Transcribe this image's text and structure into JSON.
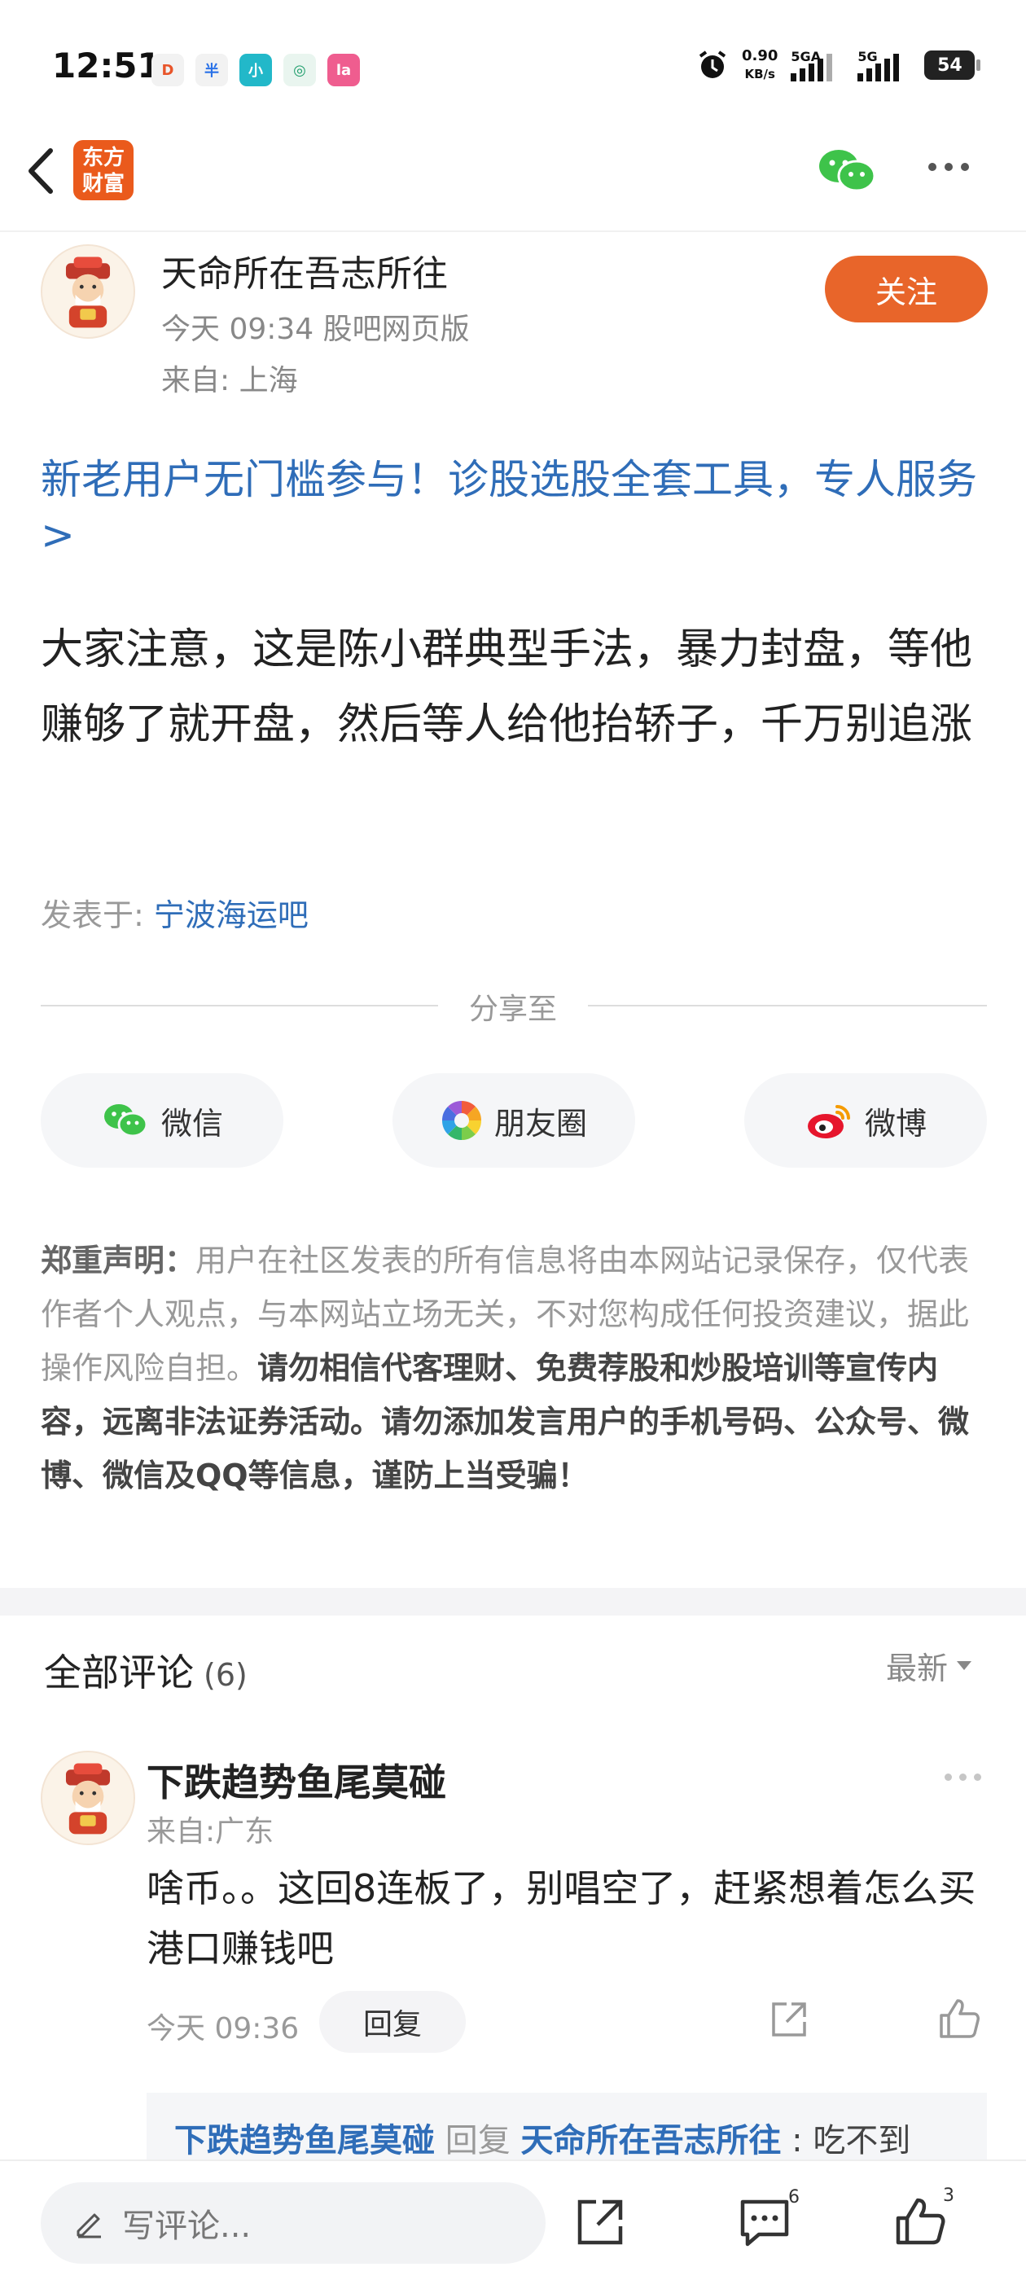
{
  "status_bar": {
    "time": "12:51",
    "app_icons": [
      {
        "icon": "taobao-icon",
        "glyph": "D",
        "color": "#f2f2f2",
        "fg": "#e8552a"
      },
      {
        "icon": "alipay-icon",
        "glyph": "半",
        "color": "#f2f2f2",
        "fg": "#2a72e8"
      },
      {
        "icon": "miniapp-icon",
        "glyph": "小",
        "color": "#22b8c9",
        "fg": "#ffffff"
      },
      {
        "icon": "vpn-icon",
        "glyph": "◎",
        "color": "#e9f5ef",
        "fg": "#1d9d6b"
      },
      {
        "icon": "lalala-icon",
        "glyph": "la",
        "color": "#ef5d8f",
        "fg": "#ffffff"
      }
    ],
    "net_speed_value": "0.90",
    "net_speed_unit": "KB/s",
    "signal1_label": "5GA",
    "signal2_label": "5G",
    "battery": "54"
  },
  "header": {
    "logo_line1": "东方",
    "logo_line2": "财富"
  },
  "post": {
    "author": "天命所在吾志所往",
    "time_source": "今天 09:34 股吧网页版",
    "location": "来自: 上海",
    "follow_label": "关注",
    "promo": "新老用户无门槛参与！诊股选股全套工具，专人服务>",
    "body": "大家注意，这是陈小群典型手法，暴力封盘，等他赚够了就开盘，然后等人给他抬轿子，千万别追涨",
    "posted_in_label": "发表于: ",
    "posted_in_bar": "宁波海运吧"
  },
  "share": {
    "title": "分享至",
    "options": [
      {
        "label": "微信",
        "icon": "wechat-icon"
      },
      {
        "label": "朋友圈",
        "icon": "moments-icon"
      },
      {
        "label": "微博",
        "icon": "weibo-icon"
      }
    ]
  },
  "disclaimer": {
    "lead": "郑重声明：",
    "normal": "用户在社区发表的所有信息将由本网站记录保存，仅代表作者个人观点，与本网站立场无关，不对您构成任何投资建议，据此操作风险自担。",
    "warning": "请勿相信代客理财、免费荐股和炒股培训等宣传内容，远离非法证券活动。请勿添加发言用户的手机号码、公众号、微博、微信及QQ等信息，谨防上当受骗！"
  },
  "comments": {
    "title": "全部评论",
    "count": "(6)",
    "sort_label": "最新",
    "items": [
      {
        "user": "下跌趋势鱼尾莫碰",
        "location": "来自:广东",
        "text": "啥币。。这回8连板了，别唱空了，赶紧想着怎么买港口赚钱吧",
        "time": "今天 09:36",
        "reply_label": "回复",
        "reply": {
          "from": "下跌趋势鱼尾莫碰",
          "verb": " 回复 ",
          "to": "天命所在吾志所往",
          "text": " : 吃不到"
        }
      }
    ]
  },
  "bottom_bar": {
    "input_placeholder": "写评论...",
    "comment_count": "6",
    "like_count": "3"
  }
}
